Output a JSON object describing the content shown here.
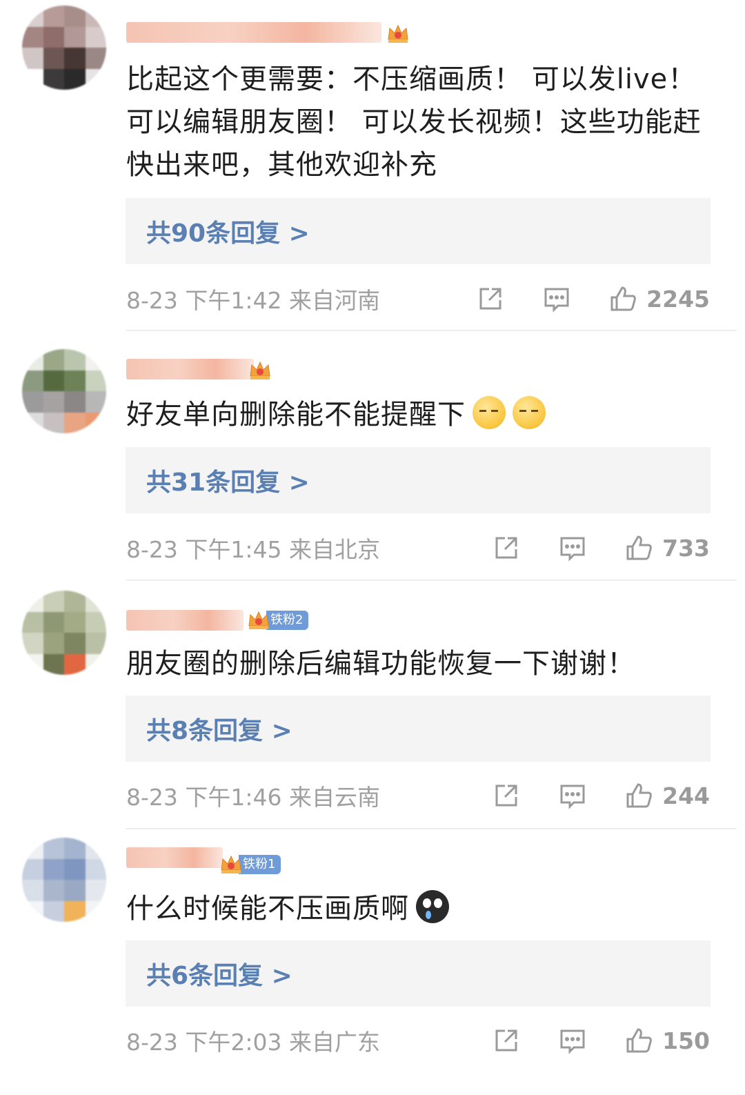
{
  "comments": [
    {
      "text": "比起这个更需要：不压缩画质！ 可以发live！ 可以编辑朋友圈！ 可以发长视频！这些功能赶快出来吧，其他欢迎补充",
      "emojis": [],
      "badge_level": "1",
      "fan_label": "",
      "replies_label": "共90条回复 >",
      "time": "8-23 下午1:42 来自河南",
      "likes": "2245"
    },
    {
      "text": "好友单向删除能不能提醒下",
      "emojis": [
        "smirk",
        "smirk"
      ],
      "badge_level": "6",
      "fan_label": "",
      "replies_label": "共31条回复 >",
      "time": "8-23 下午1:45 来自北京",
      "likes": "733"
    },
    {
      "text": "朋友圈的删除后编辑功能恢复一下谢谢！",
      "emojis": [],
      "badge_level": "7",
      "fan_label": "铁粉2",
      "replies_label": "共8条回复 >",
      "time": "8-23 下午1:46 来自云南",
      "likes": "244"
    },
    {
      "text": "什么时候能不压画质啊",
      "emojis": [
        "cry"
      ],
      "badge_level": "6",
      "fan_label": "铁粉1",
      "replies_label": "共6条回复 >",
      "time": "8-23 下午2:03 来自广东",
      "likes": "150"
    }
  ],
  "icons": {
    "share": "share-icon",
    "comment": "comment-icon",
    "like": "thumb-up-icon",
    "badge": "crown-badge-icon"
  },
  "colors": {
    "reply_link": "#5a7fb2",
    "reply_bg": "#f4f4f4",
    "meta_text": "#a0a0a0",
    "fan_tag": "#6f9bd8"
  }
}
